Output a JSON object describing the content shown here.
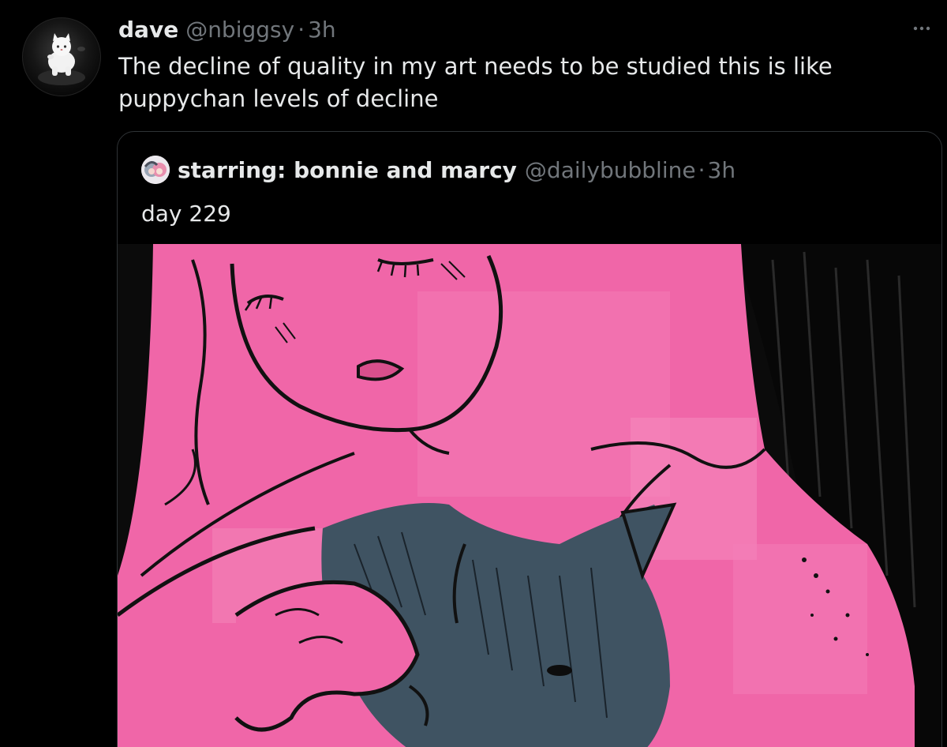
{
  "tweet": {
    "author_name": "dave",
    "author_handle": "@nbiggsy",
    "separator": "·",
    "time": "3h",
    "text": "The decline of quality in my art needs to be studied this is like puppychan levels of decline",
    "more_icon": "ellipsis-icon"
  },
  "quote": {
    "author_name": "starring: bonnie and marcy",
    "author_handle": "@dailybubbline",
    "separator": "·",
    "time": "3h",
    "text": "day 229"
  },
  "colors": {
    "background": "#000000",
    "text_primary": "#e7e9ea",
    "text_secondary": "#71767b",
    "border": "#2f3336",
    "art_pink": "#f066a8",
    "art_slate": "#3f5362"
  }
}
